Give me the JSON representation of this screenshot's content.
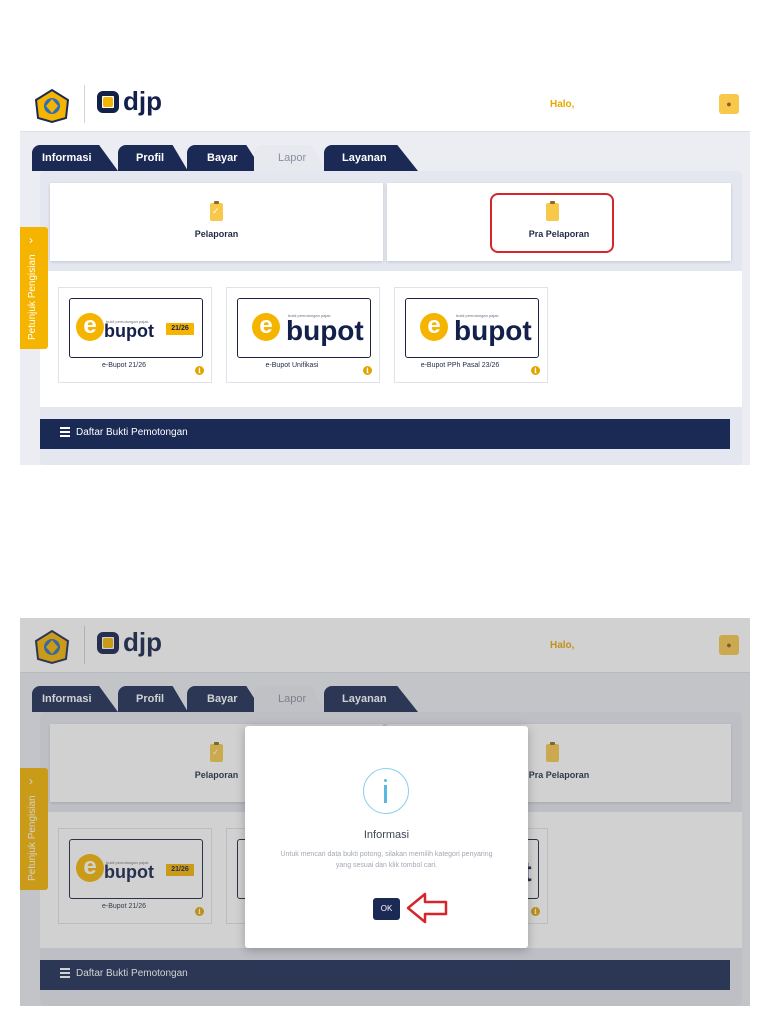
{
  "header": {
    "logo_text": "djp",
    "greeting": "Halo,",
    "user_icon": "user-icon"
  },
  "tabs": [
    {
      "label": "Informasi",
      "active": false
    },
    {
      "label": "Profil",
      "active": false
    },
    {
      "label": "Bayar",
      "active": false
    },
    {
      "label": "Lapor",
      "active": true
    },
    {
      "label": "Layanan",
      "active": false
    }
  ],
  "categories": [
    {
      "label": "Pelaporan",
      "icon": "clipboard-check-icon"
    },
    {
      "label": "Pra Pelaporan",
      "icon": "clipboard-icon"
    }
  ],
  "apps": [
    {
      "label": "e-Bupot 21/26",
      "logo_word": "bupot",
      "tag": "21/26",
      "subtext": "bukti pemotongan pajak"
    },
    {
      "label": "e-Bupot Unifikasi",
      "logo_word": "bupot",
      "tag": "",
      "subtext": "bukti pemotongan pajak"
    },
    {
      "label": "e-Bupot PPh Pasal 23/26",
      "logo_word": "bupot",
      "tag": "",
      "subtext": "bukti pemotongan pajak"
    }
  ],
  "side_tab": {
    "label": "Petunjuk Pengisian",
    "arrow": "›"
  },
  "list_header": {
    "title": "Daftar Bukti Pemotongan"
  },
  "modal": {
    "title": "Informasi",
    "message": "Untuk mencari data bukti potong, silakan memilih kategori penyaring yang sesuai dan klik tombol cari.",
    "ok_label": "OK"
  },
  "colors": {
    "navy": "#1b2a55",
    "accent": "#f5b400",
    "highlight": "#d7262b"
  }
}
